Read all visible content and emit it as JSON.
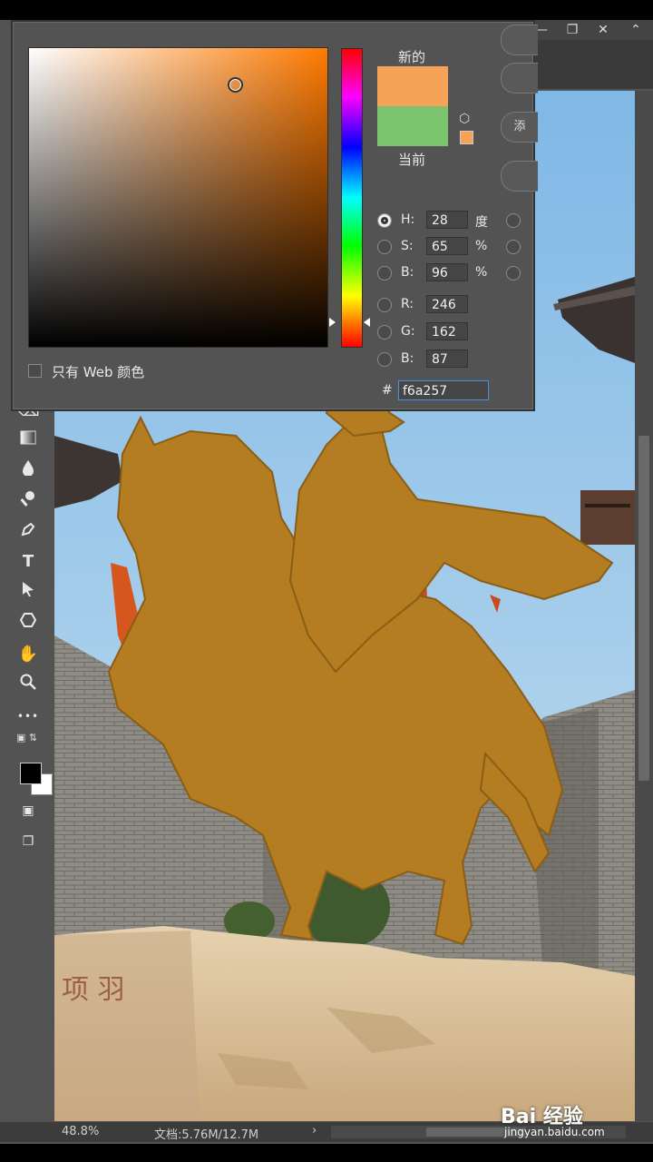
{
  "window": {
    "controls": [
      "—",
      "❐",
      "✕",
      "⌃"
    ]
  },
  "color_picker": {
    "new_label": "新的",
    "current_label": "当前",
    "new_color": "#f6a257",
    "current_color": "#7cc46e",
    "hue_gradient_color": "#ff7a00",
    "fields": {
      "h": {
        "label": "H:",
        "value": "28",
        "unit": "度"
      },
      "s": {
        "label": "S:",
        "value": "65",
        "unit": "%"
      },
      "b": {
        "label": "B:",
        "value": "96",
        "unit": "%"
      },
      "r": {
        "label": "R:",
        "value": "246"
      },
      "g": {
        "label": "G:",
        "value": "162"
      },
      "b2": {
        "label": "B:",
        "value": "87"
      }
    },
    "hash": "#",
    "hex_value": "f6a257",
    "web_only_label": "只有 Web 颜色",
    "side_buttons": [
      "",
      "",
      "添",
      ""
    ]
  },
  "toolbar": {
    "tools": [
      "eraser-icon",
      "gradient-icon",
      "blur-icon",
      "dodge-icon",
      "pen-icon",
      "type-icon",
      "path-select-icon",
      "shape-icon",
      "hand-icon",
      "zoom-icon",
      "more-icon"
    ],
    "type_glyph": "T",
    "more_glyph": "•••",
    "foreground_color": "#000000",
    "background_color": "#ffffff"
  },
  "statusbar": {
    "zoom": "48.8%",
    "doc_info": "文档:5.76M/12.7M",
    "arrow": "›"
  },
  "watermark": {
    "brand": "Bai 经验",
    "url": "jingyan.baidu.com"
  },
  "canvas": {
    "sky_color": "#8ec3e8",
    "wall_color": "#8a8a82",
    "statue_color": "#b57d22",
    "rock_color": "#d9c29e",
    "rock_inscription": "项 羽"
  }
}
